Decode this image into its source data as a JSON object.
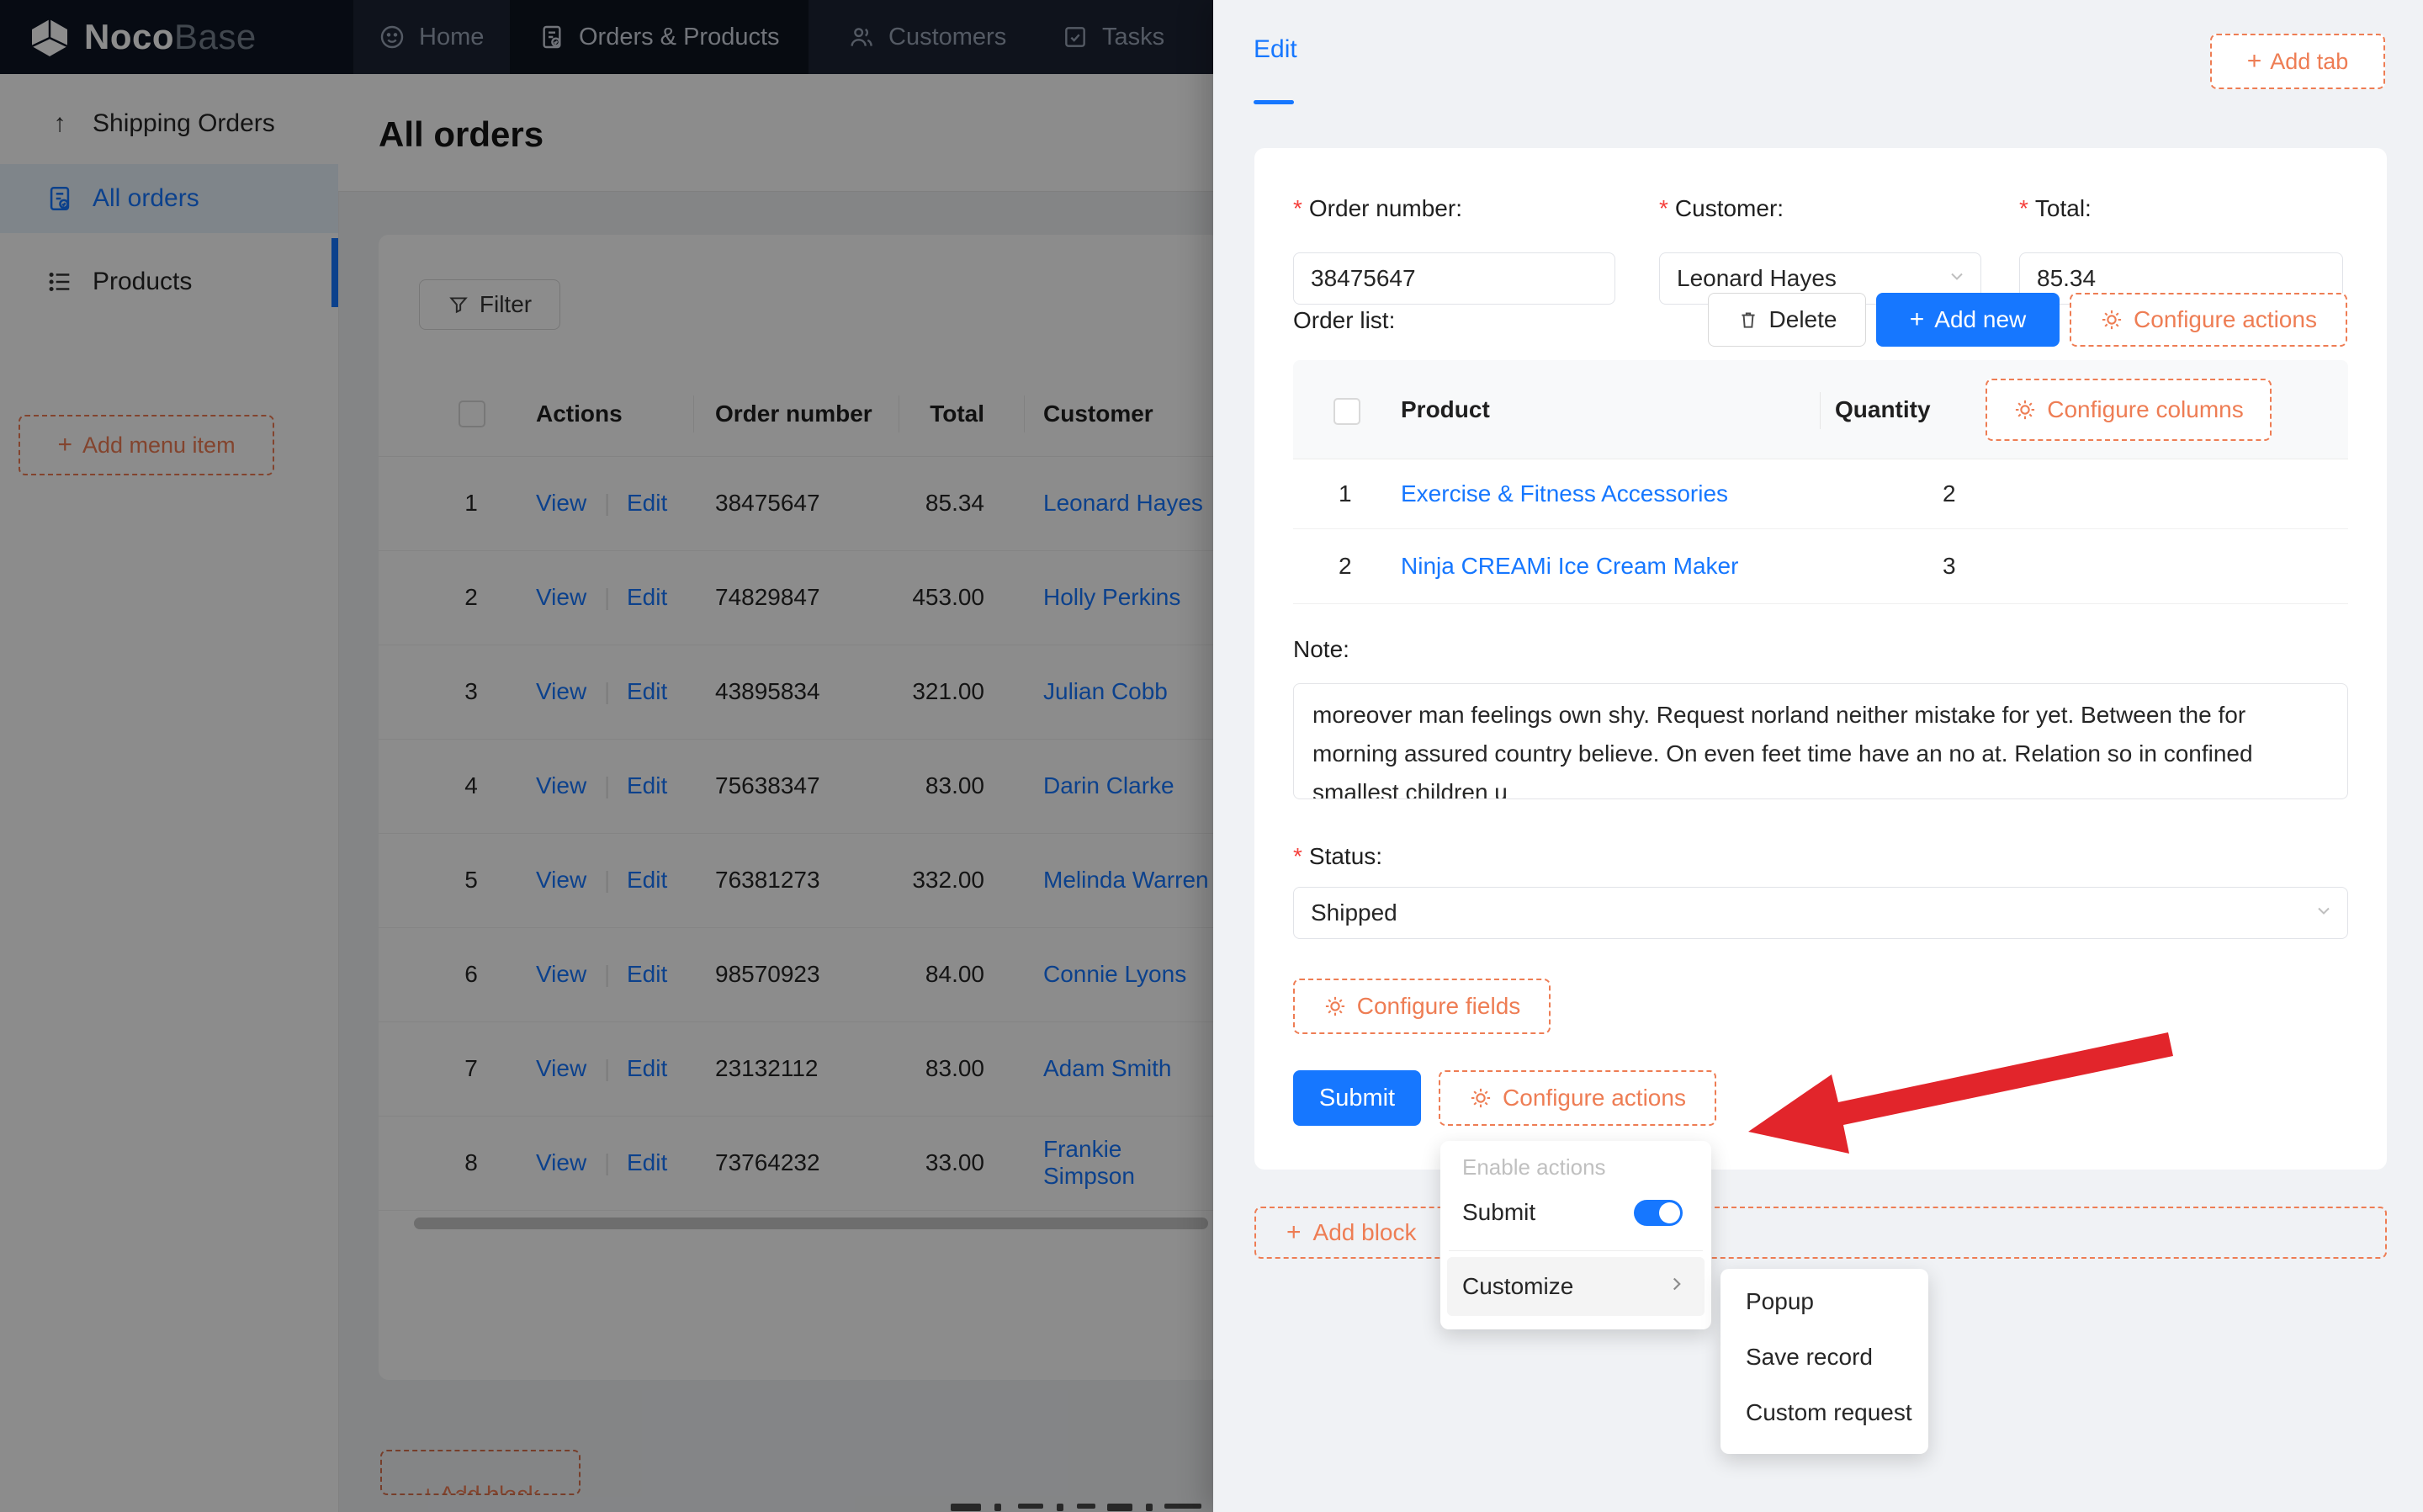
{
  "icons": {
    "plus": "+",
    "arrow_up": "↑"
  },
  "colors": {
    "accent_blue": "#1677ff",
    "designer_orange": "#ee7d54",
    "arrow_red": "#e2252b",
    "nav_bg": "#1c2433"
  },
  "topnav": {
    "brand_bold": "Noco",
    "brand_light": "Base",
    "items": [
      {
        "label": "Home"
      },
      {
        "label": "Orders & Products"
      },
      {
        "label": "Customers"
      },
      {
        "label": "Tasks"
      }
    ]
  },
  "sidebar": {
    "items": [
      {
        "label": "Shipping Orders"
      },
      {
        "label": "All orders"
      },
      {
        "label": "Products"
      }
    ],
    "add_menu_item": "Add menu item"
  },
  "main": {
    "title": "All orders",
    "filter": "Filter",
    "table": {
      "headers": {
        "actions": "Actions",
        "order_number": "Order number",
        "total": "Total",
        "customer": "Customer"
      },
      "view": "View",
      "edit": "Edit",
      "rows": [
        {
          "n": "1",
          "order": "38475647",
          "total": "85.34",
          "customer": "Leonard Hayes"
        },
        {
          "n": "2",
          "order": "74829847",
          "total": "453.00",
          "customer": "Holly Perkins"
        },
        {
          "n": "3",
          "order": "43895834",
          "total": "321.00",
          "customer": "Julian Cobb"
        },
        {
          "n": "4",
          "order": "75638347",
          "total": "83.00",
          "customer": "Darin Clarke"
        },
        {
          "n": "5",
          "order": "76381273",
          "total": "332.00",
          "customer": "Melinda Warren"
        },
        {
          "n": "6",
          "order": "98570923",
          "total": "84.00",
          "customer": "Connie Lyons"
        },
        {
          "n": "7",
          "order": "23132112",
          "total": "83.00",
          "customer": "Adam Smith"
        },
        {
          "n": "8",
          "order": "73764232",
          "total": "33.00",
          "customer": "Frankie Simpson"
        }
      ]
    },
    "add_block_clipped": "Add block"
  },
  "drawer": {
    "tab": "Edit",
    "add_tab": "Add tab",
    "required_mark": "*",
    "order_number_label": "Order number:",
    "order_number_value": "38475647",
    "customer_label": "Customer:",
    "customer_value": "Leonard Hayes",
    "total_label": "Total:",
    "total_value": "85.34",
    "order_list_label": "Order list:",
    "delete": "Delete",
    "add_new": "Add new",
    "configure_actions": "Configure actions",
    "subtable": {
      "product": "Product",
      "quantity": "Quantity",
      "configure_columns": "Configure columns",
      "rows": [
        {
          "n": "1",
          "product": "Exercise & Fitness Accessories",
          "qty": "2"
        },
        {
          "n": "2",
          "product": "Ninja CREAMi Ice Cream Maker",
          "qty": "3"
        }
      ]
    },
    "note_label": "Note:",
    "note_value": "moreover man feelings own shy. Request norland neither mistake for yet. Between the for morning assured country believe. On even feet time have an no at. Relation so in confined smallest children u",
    "status_label": "Status:",
    "status_value": "Shipped",
    "configure_fields": "Configure fields",
    "submit": "Submit",
    "configure_actions_footer": "Configure actions",
    "add_block": "Add block"
  },
  "menu": {
    "header": "Enable actions",
    "submit": "Submit",
    "customize": "Customize",
    "submenu": [
      "Popup",
      "Save record",
      "Custom request"
    ]
  }
}
